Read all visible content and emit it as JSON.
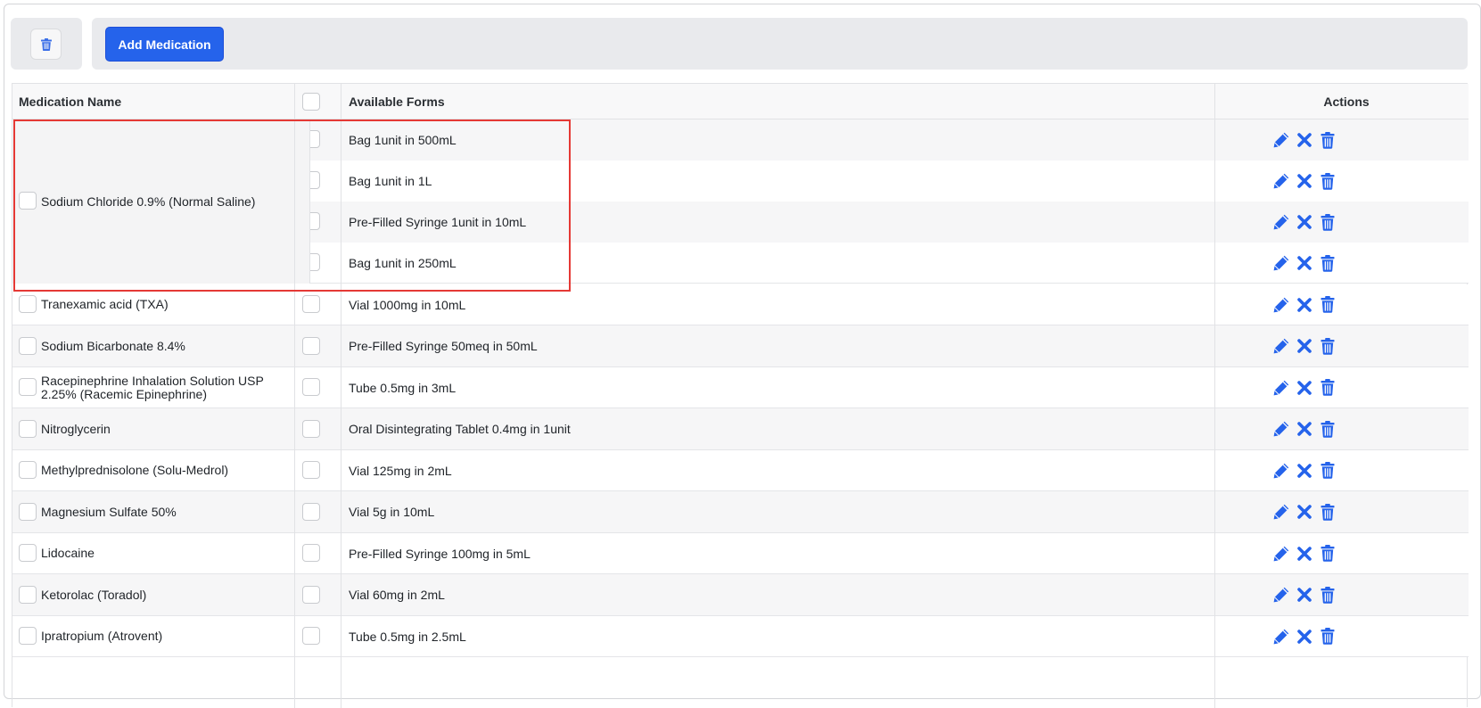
{
  "toolbar": {
    "delete_icon": "trash-icon",
    "add_label": "Add Medication"
  },
  "table": {
    "headers": {
      "name": "Medication Name",
      "forms": "Available Forms",
      "actions": "Actions"
    },
    "group": {
      "name": "Sodium Chloride 0.9% (Normal Saline)",
      "forms": [
        "Bag 1unit in 500mL",
        "Bag 1unit in 1L",
        "Pre-Filled Syringe 1unit in 10mL",
        "Bag 1unit in 250mL"
      ]
    },
    "rows": [
      {
        "name": "Tranexamic acid (TXA)",
        "form": "Vial 1000mg in 10mL"
      },
      {
        "name": "Sodium Bicarbonate 8.4%",
        "form": "Pre-Filled Syringe 50meq in 50mL"
      },
      {
        "name": "Racepinephrine Inhalation Solution USP 2.25% (Racemic Epinephrine)",
        "form": "Tube 0.5mg in 3mL"
      },
      {
        "name": "Nitroglycerin",
        "form": "Oral Disintegrating Tablet 0.4mg in 1unit"
      },
      {
        "name": "Methylprednisolone (Solu-Medrol)",
        "form": "Vial 125mg in 2mL"
      },
      {
        "name": "Magnesium Sulfate 50%",
        "form": "Vial 5g in 10mL"
      },
      {
        "name": "Lidocaine",
        "form": "Pre-Filled Syringe 100mg in 5mL"
      },
      {
        "name": "Ketorolac (Toradol)",
        "form": "Vial 60mg in 2mL"
      },
      {
        "name": "Ipratropium (Atrovent)",
        "form": "Tube 0.5mg in 2.5mL"
      }
    ],
    "action_icons": [
      "pencil-icon",
      "close-icon",
      "trash-icon"
    ]
  },
  "colors": {
    "accent": "#2563eb",
    "highlight": "#e53935"
  }
}
